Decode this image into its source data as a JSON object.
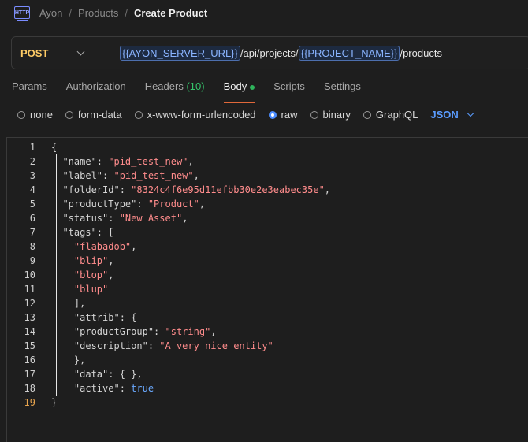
{
  "breadcrumb": {
    "icon": "http-file-icon",
    "icon_text": "HTTP",
    "items": [
      "Ayon",
      "Products"
    ],
    "current": "Create Product",
    "separator": "/"
  },
  "request": {
    "method": "POST",
    "url_parts": [
      {
        "type": "var",
        "text": "{{AYON_SERVER_URL}}"
      },
      {
        "type": "text",
        "text": "/api/projects/"
      },
      {
        "type": "var",
        "text": "{{PROJECT_NAME}}"
      },
      {
        "type": "text",
        "text": "/products"
      }
    ]
  },
  "tabs": [
    {
      "label": "Params"
    },
    {
      "label": "Authorization"
    },
    {
      "label": "Headers",
      "count": "(10)"
    },
    {
      "label": "Body",
      "active": true,
      "dot": true
    },
    {
      "label": "Scripts"
    },
    {
      "label": "Settings"
    }
  ],
  "body_types": [
    {
      "label": "none",
      "selected": false
    },
    {
      "label": "form-data",
      "selected": false
    },
    {
      "label": "x-www-form-urlencoded",
      "selected": false
    },
    {
      "label": "raw",
      "selected": true
    },
    {
      "label": "binary",
      "selected": false
    },
    {
      "label": "GraphQL",
      "selected": false
    }
  ],
  "language": "JSON",
  "editor": {
    "current_line": 19,
    "lines": [
      [
        [
          "p",
          "{"
        ]
      ],
      [
        [
          "k",
          "  \"name\""
        ],
        [
          "p",
          ": "
        ],
        [
          "s",
          "\"pid_test_new\""
        ],
        [
          "p",
          ","
        ]
      ],
      [
        [
          "k",
          "  \"label\""
        ],
        [
          "p",
          ": "
        ],
        [
          "s",
          "\"pid_test_new\""
        ],
        [
          "p",
          ","
        ]
      ],
      [
        [
          "k",
          "  \"folderId\""
        ],
        [
          "p",
          ": "
        ],
        [
          "s",
          "\"8324c4f6e95d11efbb30e2e3eabec35e\""
        ],
        [
          "p",
          ","
        ]
      ],
      [
        [
          "k",
          "  \"productType\""
        ],
        [
          "p",
          ": "
        ],
        [
          "s",
          "\"Product\""
        ],
        [
          "p",
          ","
        ]
      ],
      [
        [
          "k",
          "  \"status\""
        ],
        [
          "p",
          ": "
        ],
        [
          "s",
          "\"New Asset\""
        ],
        [
          "p",
          ","
        ]
      ],
      [
        [
          "k",
          "  \"tags\""
        ],
        [
          "p",
          ": ["
        ]
      ],
      [
        [
          "s",
          "    \"flabadob\""
        ],
        [
          "p",
          ","
        ]
      ],
      [
        [
          "s",
          "    \"blip\""
        ],
        [
          "p",
          ","
        ]
      ],
      [
        [
          "s",
          "    \"blop\""
        ],
        [
          "p",
          ","
        ]
      ],
      [
        [
          "s",
          "    \"blup\""
        ]
      ],
      [
        [
          "p",
          "    ],"
        ]
      ],
      [
        [
          "k",
          "    \"attrib\""
        ],
        [
          "p",
          ": {"
        ]
      ],
      [
        [
          "k",
          "    \"productGroup\""
        ],
        [
          "p",
          ": "
        ],
        [
          "s",
          "\"string\""
        ],
        [
          "p",
          ","
        ]
      ],
      [
        [
          "k",
          "    \"description\""
        ],
        [
          "p",
          ": "
        ],
        [
          "s",
          "\"A very nice entity\""
        ]
      ],
      [
        [
          "p",
          "    },"
        ]
      ],
      [
        [
          "k",
          "    \"data\""
        ],
        [
          "p",
          ": { },"
        ]
      ],
      [
        [
          "k",
          "    \"active\""
        ],
        [
          "p",
          ": "
        ],
        [
          "b",
          "true"
        ]
      ],
      [
        [
          "p",
          "}"
        ]
      ]
    ]
  }
}
